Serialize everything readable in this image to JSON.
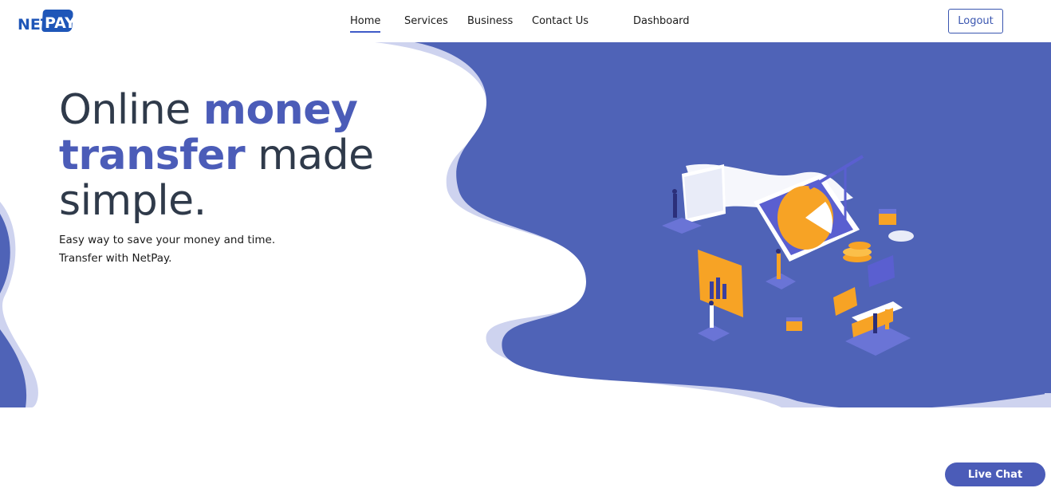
{
  "brand": {
    "logo_left": "NET",
    "logo_right": "PAY",
    "colors": {
      "primary": "#4b5cb8",
      "logo": "#1f56b8",
      "blob_light": "#ced3ef",
      "text": "#2f3a4a"
    }
  },
  "nav": {
    "items": [
      {
        "label": "Home",
        "active": true
      },
      {
        "label": "Services"
      },
      {
        "label": "Business"
      },
      {
        "label": "Contact Us"
      },
      {
        "label": "Dashboard"
      }
    ],
    "logout_label": "Logout"
  },
  "hero": {
    "headline_part1": "Online ",
    "headline_accent1": "money",
    "headline_accent2": "transfer",
    "headline_part2": " made",
    "headline_part3": "simple.",
    "subtext_line1": "Easy way to save your money and time.",
    "subtext_line2": "Transfer with NetPay."
  },
  "live_chat": {
    "label": "Live Chat"
  }
}
